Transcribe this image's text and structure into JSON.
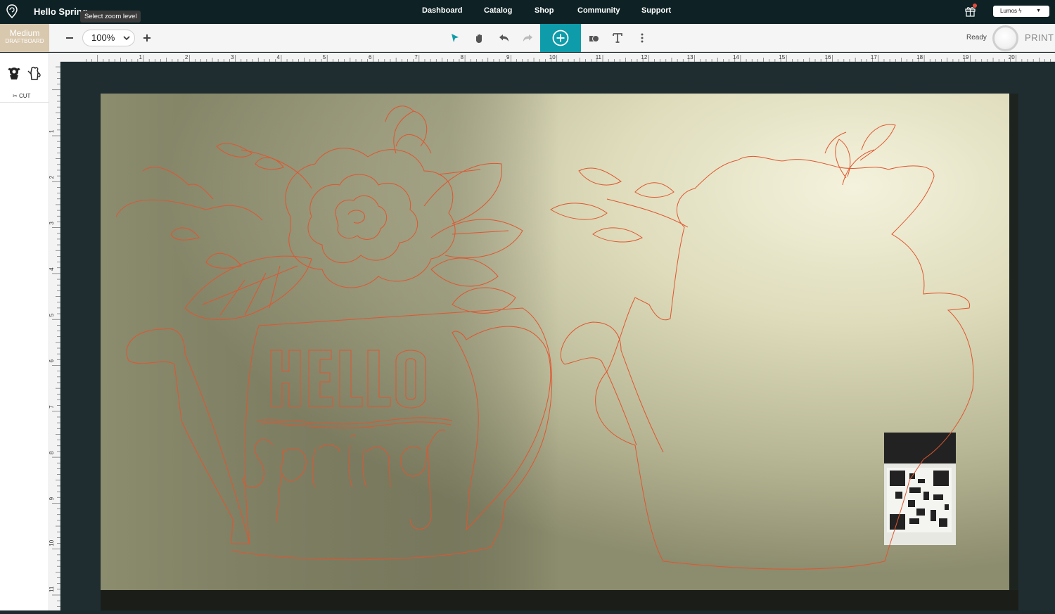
{
  "app": {
    "document_title": "Hello Spring",
    "tooltip": "Select zoom level",
    "nav": [
      "Dashboard",
      "Catalog",
      "Shop",
      "Community",
      "Support"
    ],
    "account_label": "Lumos",
    "account_icon": "lightning-bolt-icon"
  },
  "toolbar": {
    "material_name": "Medium",
    "material_type": "DRAFTBOARD",
    "zoom_value": "100%",
    "status": "Ready",
    "print_label": "PRINT",
    "tools": [
      "zoom-out-icon",
      "zoom-in-icon",
      "pointer-icon",
      "hand-icon",
      "undo-icon",
      "redo-icon",
      "add-icon",
      "shapes-icon",
      "text-icon",
      "more-icon"
    ]
  },
  "leftpanel": {
    "thumbnails": [
      "flower-bouquet-thumbnail",
      "watering-can-thumbnail"
    ],
    "operation_label": "CUT"
  },
  "rulers": {
    "horizontal": [
      "1",
      "2",
      "3",
      "4",
      "5",
      "6",
      "7",
      "8",
      "9",
      "10",
      "11",
      "12",
      "13",
      "14",
      "15",
      "16",
      "17",
      "18",
      "19",
      "20"
    ],
    "vertical": [
      "1",
      "2",
      "3",
      "4",
      "5",
      "6",
      "7",
      "8",
      "9",
      "10",
      "11"
    ]
  },
  "design": {
    "text_line1": "HELLO",
    "text_line2": "Spring"
  },
  "colors": {
    "topbar": "#0e2226",
    "accent": "#0e9baa",
    "material": "#d8c8ae",
    "cut_line": "#e0562f",
    "workarea": "#1f2d31"
  }
}
